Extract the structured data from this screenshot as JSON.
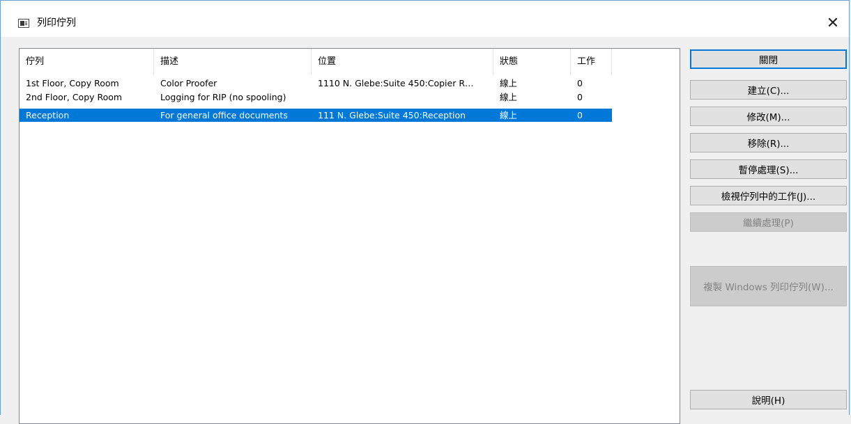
{
  "window": {
    "title": "列印佇列",
    "close_label": "✕"
  },
  "columns": [
    "佇列",
    "描述",
    "位置",
    "狀態",
    "工作"
  ],
  "rows": [
    {
      "queue": "1st Floor, Copy Room",
      "description": "Color Proofer",
      "location": "1110 N. Glebe:Suite 450:Copier R…",
      "status": "線上",
      "jobs": "0",
      "selected": false
    },
    {
      "queue": "2nd Floor, Copy Room",
      "description": "Logging for RIP (no spooling)",
      "location": "",
      "status": "線上",
      "jobs": "0",
      "selected": false
    },
    {
      "queue": "Reception",
      "description": "For general office documents",
      "location": "111 N. Glebe:Suite 450:Reception",
      "status": "線上",
      "jobs": "0",
      "selected": true
    }
  ],
  "buttons": {
    "close": "關閉",
    "create": "建立(C)...",
    "modify": "修改(M)...",
    "remove": "移除(R)...",
    "pause": "暫停處理(S)...",
    "view_jobs": "檢視佇列中的工作(J)...",
    "resume": "繼續處理(P)",
    "copy_windows": "複製 Windows 列印佇列(W)...",
    "help": "說明(H)"
  },
  "colors": {
    "selection": "#0078d7",
    "default_button_border": "#0078d7"
  }
}
